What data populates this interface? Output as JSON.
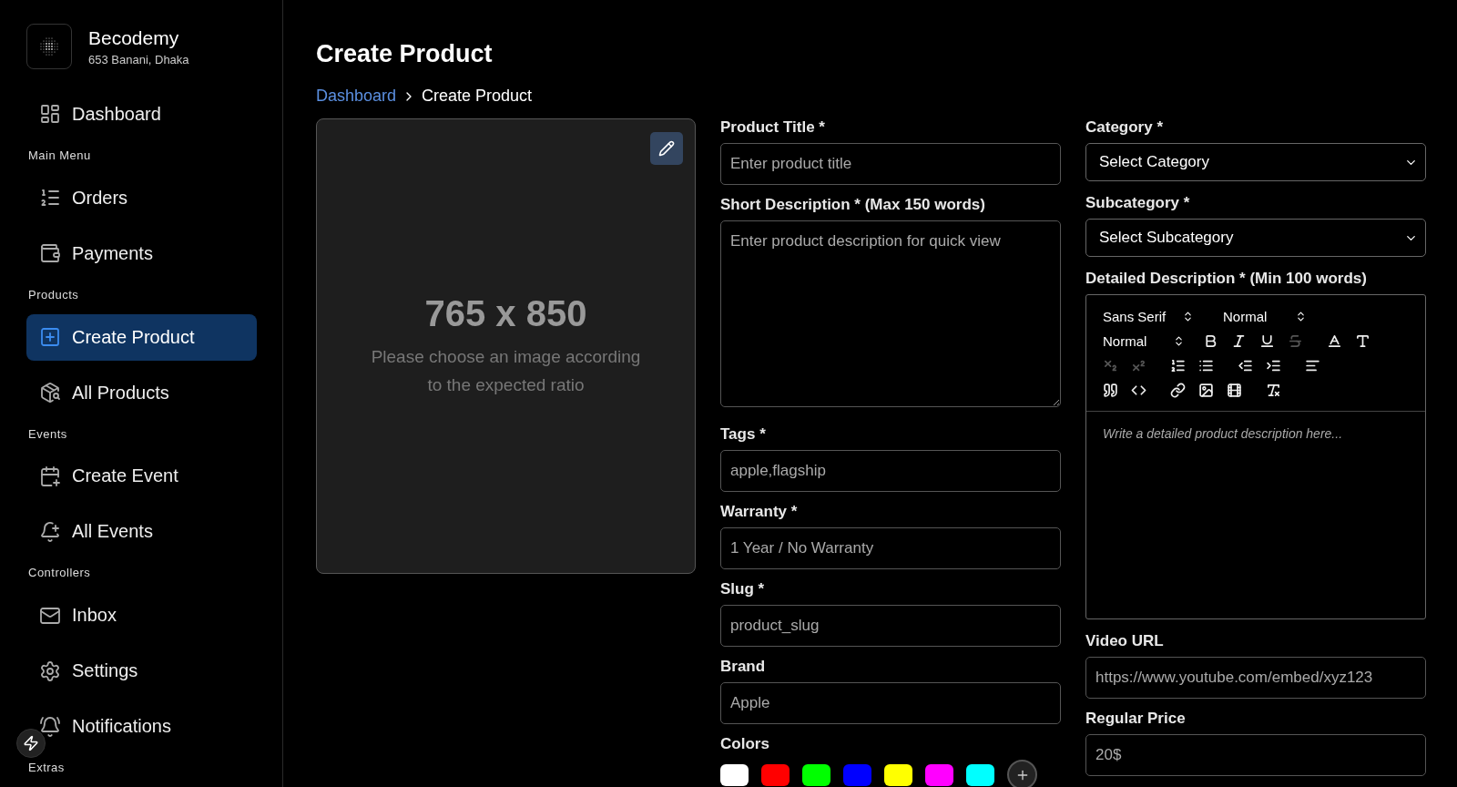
{
  "brand": {
    "name": "Becodemy",
    "address": "653 Banani, Dhaka"
  },
  "sidebar": [
    {
      "kind": "item",
      "label": "Dashboard",
      "selected": false
    },
    {
      "kind": "heading",
      "label": "Main Menu"
    },
    {
      "kind": "item",
      "label": "Orders",
      "selected": false
    },
    {
      "kind": "item",
      "label": "Payments",
      "selected": false
    },
    {
      "kind": "heading",
      "label": "Products"
    },
    {
      "kind": "item",
      "label": "Create Product",
      "selected": true
    },
    {
      "kind": "item",
      "label": "All Products",
      "selected": false
    },
    {
      "kind": "heading",
      "label": "Events"
    },
    {
      "kind": "item",
      "label": "Create Event",
      "selected": false
    },
    {
      "kind": "item",
      "label": "All Events",
      "selected": false
    },
    {
      "kind": "heading",
      "label": "Controllers"
    },
    {
      "kind": "item",
      "label": "Inbox",
      "selected": false
    },
    {
      "kind": "item",
      "label": "Settings",
      "selected": false
    },
    {
      "kind": "item",
      "label": "Notifications",
      "selected": false
    },
    {
      "kind": "heading",
      "label": "Extras"
    }
  ],
  "page": {
    "title": "Create Product",
    "breadcrumb": [
      {
        "label": "Dashboard",
        "link": true
      },
      {
        "label": "Create Product",
        "link": false
      }
    ]
  },
  "image_upload": {
    "size": "765 x 850",
    "hint": "Please choose an image according to the expected ratio"
  },
  "form_middle": [
    {
      "kind": "input",
      "label": "Product Title *",
      "placeholder": "Enter product title"
    },
    {
      "kind": "textarea",
      "label": "Short Description * (Max 150 words)",
      "placeholder": "Enter product description for quick view"
    },
    {
      "kind": "input",
      "label": "Tags *",
      "placeholder": "apple,flagship"
    },
    {
      "kind": "input",
      "label": "Warranty *",
      "placeholder": "1 Year / No Warranty"
    },
    {
      "kind": "input",
      "label": "Slug *",
      "placeholder": "product_slug"
    },
    {
      "kind": "input",
      "label": "Brand",
      "placeholder": "Apple"
    }
  ],
  "colors": {
    "label": "Colors",
    "swatches": [
      {
        "color": "#ffffff"
      },
      {
        "color": "#ff0000"
      },
      {
        "color": "#00ff00"
      },
      {
        "color": "#0000ff"
      },
      {
        "color": "#ffff00"
      },
      {
        "color": "#ff00ff"
      },
      {
        "color": "#00ffff"
      }
    ]
  },
  "form_right": [
    {
      "kind": "select",
      "label": "Category *",
      "value": "Select Category"
    },
    {
      "kind": "select",
      "label": "Subcategory *",
      "value": "Select Subcategory"
    },
    {
      "kind": "editor",
      "label": "Detailed Description * (Min 100 words)",
      "placeholder": "Write a detailed product description here..."
    },
    {
      "kind": "input",
      "label": "Video URL",
      "placeholder": "https://www.youtube.com/embed/xyz123"
    },
    {
      "kind": "input",
      "label": "Regular Price",
      "placeholder": "20$"
    }
  ],
  "editor": {
    "font": "Sans Serif",
    "size": "Normal",
    "heading": "Normal",
    "tools": [
      [
        {
          "kind": "bold",
          "disabled": false
        },
        {
          "kind": "italic",
          "disabled": false
        },
        {
          "kind": "underline",
          "disabled": false
        },
        {
          "kind": "strike",
          "disabled": true
        },
        {
          "kind": "gap"
        },
        {
          "kind": "color",
          "disabled": false
        },
        {
          "kind": "background",
          "disabled": false
        }
      ],
      [
        {
          "kind": "subscript",
          "disabled": true
        },
        {
          "kind": "superscript",
          "disabled": true
        },
        {
          "kind": "gap"
        },
        {
          "kind": "ordered-list",
          "disabled": false
        },
        {
          "kind": "bullet-list",
          "disabled": false
        },
        {
          "kind": "gap"
        },
        {
          "kind": "outdent",
          "disabled": false
        },
        {
          "kind": "indent",
          "disabled": false
        },
        {
          "kind": "gap"
        },
        {
          "kind": "align",
          "disabled": false
        }
      ],
      [
        {
          "kind": "quote",
          "disabled": false
        },
        {
          "kind": "code",
          "disabled": false
        },
        {
          "kind": "gap"
        },
        {
          "kind": "link",
          "disabled": false
        },
        {
          "kind": "image",
          "disabled": false
        },
        {
          "kind": "video",
          "disabled": false
        },
        {
          "kind": "gap"
        },
        {
          "kind": "clean",
          "disabled": false
        }
      ]
    ]
  }
}
